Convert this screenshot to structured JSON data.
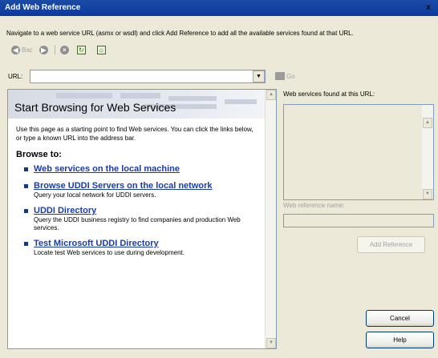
{
  "window": {
    "title": "Add Web Reference",
    "close_glyph": "x"
  },
  "instructions": "Navigate to a web service URL (asmx or wsdl) and click Add Reference to add all the available services found at that URL.",
  "nav": {
    "back_label": "Bac"
  },
  "url": {
    "label": "URL:",
    "value": "",
    "go_label": "Go"
  },
  "browser": {
    "banner_title": "Start Browsing for Web Services",
    "intro": "Use this page as a starting point to find Web services. You can click the links below, or type a known URL into the address bar.",
    "browse_to": "Browse to:",
    "links": [
      {
        "title": "Web services on the local machine",
        "desc": ""
      },
      {
        "title": "Browse UDDI Servers on the local network",
        "desc": "Query your local network for UDDI servers."
      },
      {
        "title": "UDDI Directory",
        "desc": "Query the UDDI business registry to find companies and production Web services."
      },
      {
        "title": "Test Microsoft UDDI Directory",
        "desc": "Locate test Web services to use during development."
      }
    ]
  },
  "right": {
    "services_label": "Web services found at this URL:",
    "refname_label": "Web reference name:",
    "refname_value": "",
    "add_reference": "Add Reference",
    "cancel": "Cancel",
    "help": "Help"
  }
}
